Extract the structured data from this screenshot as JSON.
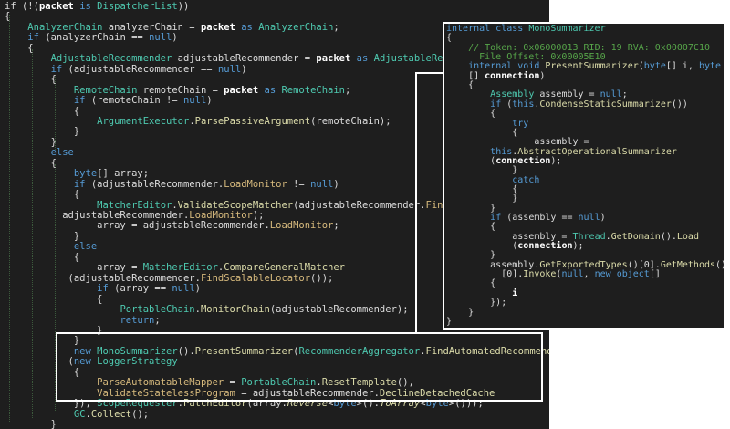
{
  "editor": {
    "lines": [
      [
        {
          "t": "if (!(",
          "c": ""
        },
        {
          "t": "packet",
          "c": "bold"
        },
        {
          "t": " is ",
          "c": "kw"
        },
        {
          "t": "DispatcherList",
          "c": "ty"
        },
        {
          "t": "))",
          "c": ""
        }
      ],
      [
        {
          "t": "{",
          "c": ""
        }
      ],
      [
        {
          "t": "    ",
          "c": ""
        },
        {
          "t": "AnalyzerChain",
          "c": "ty"
        },
        {
          "t": " analyzerChain = ",
          "c": ""
        },
        {
          "t": "packet",
          "c": "bold"
        },
        {
          "t": " as ",
          "c": "kw"
        },
        {
          "t": "AnalyzerChain",
          "c": "ty"
        },
        {
          "t": ";",
          "c": ""
        }
      ],
      [
        {
          "t": "    ",
          "c": ""
        },
        {
          "t": "if",
          "c": "kw"
        },
        {
          "t": " (analyzerChain == ",
          "c": ""
        },
        {
          "t": "null",
          "c": "kw"
        },
        {
          "t": ")",
          "c": ""
        }
      ],
      [
        {
          "t": "    {",
          "c": ""
        }
      ],
      [
        {
          "t": "        ",
          "c": ""
        },
        {
          "t": "AdjustableRecommender",
          "c": "ty"
        },
        {
          "t": " adjustableRecommender = ",
          "c": ""
        },
        {
          "t": "packet",
          "c": "bold"
        },
        {
          "t": " as ",
          "c": "kw"
        },
        {
          "t": "AdjustableRecommender",
          "c": "ty"
        },
        {
          "t": ";",
          "c": ""
        }
      ],
      [
        {
          "t": "        ",
          "c": ""
        },
        {
          "t": "if",
          "c": "kw"
        },
        {
          "t": " (adjustableRecommender == ",
          "c": ""
        },
        {
          "t": "null",
          "c": "kw"
        },
        {
          "t": ")",
          "c": ""
        }
      ],
      [
        {
          "t": "        {",
          "c": ""
        }
      ],
      [
        {
          "t": "            ",
          "c": ""
        },
        {
          "t": "RemoteChain",
          "c": "ty"
        },
        {
          "t": " remoteChain = ",
          "c": ""
        },
        {
          "t": "packet",
          "c": "bold"
        },
        {
          "t": " as ",
          "c": "kw"
        },
        {
          "t": "RemoteChain",
          "c": "ty"
        },
        {
          "t": ";",
          "c": ""
        }
      ],
      [
        {
          "t": "            ",
          "c": ""
        },
        {
          "t": "if",
          "c": "kw"
        },
        {
          "t": " (remoteChain != ",
          "c": ""
        },
        {
          "t": "null",
          "c": "kw"
        },
        {
          "t": ")",
          "c": ""
        }
      ],
      [
        {
          "t": "            {",
          "c": ""
        }
      ],
      [
        {
          "t": "                ",
          "c": ""
        },
        {
          "t": "ArgumentExecutor",
          "c": "ty"
        },
        {
          "t": ".",
          "c": ""
        },
        {
          "t": "ParsePassiveArgument",
          "c": "fn"
        },
        {
          "t": "(remoteChain);",
          "c": ""
        }
      ],
      [
        {
          "t": "            }",
          "c": ""
        }
      ],
      [
        {
          "t": "        }",
          "c": ""
        }
      ],
      [
        {
          "t": "        ",
          "c": ""
        },
        {
          "t": "else",
          "c": "kw"
        }
      ],
      [
        {
          "t": "        {",
          "c": ""
        }
      ],
      [
        {
          "t": "            ",
          "c": ""
        },
        {
          "t": "byte",
          "c": "kw"
        },
        {
          "t": "[] array;",
          "c": ""
        }
      ],
      [
        {
          "t": "            ",
          "c": ""
        },
        {
          "t": "if",
          "c": "kw"
        },
        {
          "t": " (adjustableRecommender.",
          "c": ""
        },
        {
          "t": "LoadMonitor",
          "c": "pr"
        },
        {
          "t": " != ",
          "c": ""
        },
        {
          "t": "null",
          "c": "kw"
        },
        {
          "t": ")",
          "c": ""
        }
      ],
      [
        {
          "t": "            {",
          "c": ""
        }
      ],
      [
        {
          "t": "                ",
          "c": ""
        },
        {
          "t": "MatcherEditor",
          "c": "ty"
        },
        {
          "t": ".",
          "c": ""
        },
        {
          "t": "ValidateScopeMatcher",
          "c": "fn"
        },
        {
          "t": "(adjustableRecommender.",
          "c": ""
        },
        {
          "t": "FindScalableLocator",
          "c": "pr"
        },
        {
          "t": "(),",
          "c": ""
        }
      ],
      [
        {
          "t": "          adjustableRecommender.",
          "c": ""
        },
        {
          "t": "LoadMonitor",
          "c": "pr"
        },
        {
          "t": ");",
          "c": ""
        }
      ],
      [
        {
          "t": "                array = adjustableRecommender.",
          "c": ""
        },
        {
          "t": "LoadMonitor",
          "c": "pr"
        },
        {
          "t": ";",
          "c": ""
        }
      ],
      [
        {
          "t": "            }",
          "c": ""
        }
      ],
      [
        {
          "t": "            ",
          "c": ""
        },
        {
          "t": "else",
          "c": "kw"
        }
      ],
      [
        {
          "t": "            {",
          "c": ""
        }
      ],
      [
        {
          "t": "                array = ",
          "c": ""
        },
        {
          "t": "MatcherEditor",
          "c": "ty"
        },
        {
          "t": ".",
          "c": ""
        },
        {
          "t": "CompareGeneralMatcher",
          "c": "fn"
        }
      ],
      [
        {
          "t": "           (adjustableRecommender.",
          "c": ""
        },
        {
          "t": "FindScalableLocator",
          "c": "pr"
        },
        {
          "t": "());",
          "c": ""
        }
      ],
      [
        {
          "t": "                ",
          "c": ""
        },
        {
          "t": "if",
          "c": "kw"
        },
        {
          "t": " (array == ",
          "c": ""
        },
        {
          "t": "null",
          "c": "kw"
        },
        {
          "t": ")",
          "c": ""
        }
      ],
      [
        {
          "t": "                {",
          "c": ""
        }
      ],
      [
        {
          "t": "                    ",
          "c": ""
        },
        {
          "t": "PortableChain",
          "c": "ty"
        },
        {
          "t": ".",
          "c": ""
        },
        {
          "t": "MonitorChain",
          "c": "fn"
        },
        {
          "t": "(adjustableRecommender);",
          "c": ""
        }
      ],
      [
        {
          "t": "                    ",
          "c": ""
        },
        {
          "t": "return",
          "c": "kw"
        },
        {
          "t": ";",
          "c": ""
        }
      ],
      [
        {
          "t": "                }",
          "c": ""
        }
      ],
      [
        {
          "t": "            }",
          "c": ""
        }
      ],
      [
        {
          "t": "            ",
          "c": ""
        },
        {
          "t": "new",
          "c": "kw"
        },
        {
          "t": " ",
          "c": ""
        },
        {
          "t": "MonoSummarizer",
          "c": "ty"
        },
        {
          "t": "().",
          "c": ""
        },
        {
          "t": "PresentSummarizer",
          "c": "fn"
        },
        {
          "t": "(",
          "c": ""
        },
        {
          "t": "RecommenderAggregator",
          "c": "ty"
        },
        {
          "t": ".",
          "c": ""
        },
        {
          "t": "FindAutomatedRecommender",
          "c": "fn"
        }
      ],
      [
        {
          "t": "           (",
          "c": ""
        },
        {
          "t": "new",
          "c": "kw"
        },
        {
          "t": " ",
          "c": ""
        },
        {
          "t": "LoggerStrategy",
          "c": "ty"
        }
      ],
      [
        {
          "t": "            {",
          "c": ""
        }
      ],
      [
        {
          "t": "                ",
          "c": ""
        },
        {
          "t": "ParseAutomatableMapper",
          "c": "pr"
        },
        {
          "t": " = ",
          "c": ""
        },
        {
          "t": "PortableChain",
          "c": "ty"
        },
        {
          "t": ".",
          "c": ""
        },
        {
          "t": "ResetTemplate",
          "c": "fn"
        },
        {
          "t": "(),",
          "c": ""
        }
      ],
      [
        {
          "t": "                ",
          "c": ""
        },
        {
          "t": "ValidateStatelessProgram",
          "c": "pr"
        },
        {
          "t": " = adjustableRecommender.",
          "c": ""
        },
        {
          "t": "DeclineDetachedCache",
          "c": "fn"
        }
      ],
      [
        {
          "t": "            }), ",
          "c": ""
        },
        {
          "t": "ScopeRequester",
          "c": "ty"
        },
        {
          "t": ".",
          "c": ""
        },
        {
          "t": "PatchEditor",
          "c": "fn"
        },
        {
          "t": "(array.",
          "c": ""
        },
        {
          "t": "Reverse",
          "c": "fn it"
        },
        {
          "t": "<",
          "c": ""
        },
        {
          "t": "byte",
          "c": "kw"
        },
        {
          "t": ">().",
          "c": ""
        },
        {
          "t": "ToArray",
          "c": "fn it"
        },
        {
          "t": "<",
          "c": ""
        },
        {
          "t": "byte",
          "c": "kw"
        },
        {
          "t": ">()));",
          "c": ""
        }
      ],
      [
        {
          "t": "            ",
          "c": ""
        },
        {
          "t": "GC",
          "c": "ty"
        },
        {
          "t": ".",
          "c": ""
        },
        {
          "t": "Collect",
          "c": "fn"
        },
        {
          "t": "();",
          "c": ""
        }
      ],
      [
        {
          "t": "        }",
          "c": ""
        }
      ],
      [
        {
          "t": "    }",
          "c": ""
        }
      ]
    ]
  },
  "popup": {
    "lines": [
      [
        {
          "t": "internal class ",
          "c": "kw"
        },
        {
          "t": "MonoSummarizer",
          "c": "ty"
        }
      ],
      [
        {
          "t": "{",
          "c": ""
        }
      ],
      [
        {
          "t": "    ",
          "c": ""
        },
        {
          "t": "// Token: 0x06000013 RID: 19 RVA: 0x00007C10",
          "c": "cm"
        }
      ],
      [
        {
          "t": "      ",
          "c": ""
        },
        {
          "t": "File Offset: 0x00005E10",
          "c": "cm"
        }
      ],
      [
        {
          "t": "    ",
          "c": ""
        },
        {
          "t": "internal void ",
          "c": "kw"
        },
        {
          "t": "PresentSummarizer",
          "c": "fn"
        },
        {
          "t": "(",
          "c": ""
        },
        {
          "t": "byte",
          "c": "kw"
        },
        {
          "t": "[] i, ",
          "c": ""
        },
        {
          "t": "byte",
          "c": "kw"
        }
      ],
      [
        {
          "t": "    [] ",
          "c": ""
        },
        {
          "t": "connection",
          "c": "bold"
        },
        {
          "t": ")",
          "c": ""
        }
      ],
      [
        {
          "t": "    {",
          "c": ""
        }
      ],
      [
        {
          "t": "        ",
          "c": ""
        },
        {
          "t": "Assembly",
          "c": "ty"
        },
        {
          "t": " assembly = ",
          "c": ""
        },
        {
          "t": "null",
          "c": "kw"
        },
        {
          "t": ";",
          "c": ""
        }
      ],
      [
        {
          "t": "        ",
          "c": ""
        },
        {
          "t": "if",
          "c": "kw"
        },
        {
          "t": " (",
          "c": ""
        },
        {
          "t": "this",
          "c": "kw"
        },
        {
          "t": ".",
          "c": ""
        },
        {
          "t": "CondenseStaticSummarizer",
          "c": "fn"
        },
        {
          "t": "())",
          "c": ""
        }
      ],
      [
        {
          "t": "        {",
          "c": ""
        }
      ],
      [
        {
          "t": "            ",
          "c": ""
        },
        {
          "t": "try",
          "c": "kw"
        }
      ],
      [
        {
          "t": "            {",
          "c": ""
        }
      ],
      [
        {
          "t": "                assembly =",
          "c": ""
        }
      ],
      [
        {
          "t": "        ",
          "c": ""
        },
        {
          "t": "this",
          "c": "kw"
        },
        {
          "t": ".",
          "c": ""
        },
        {
          "t": "AbstractOperationalSummarizer",
          "c": "fn"
        }
      ],
      [
        {
          "t": "        (",
          "c": ""
        },
        {
          "t": "connection",
          "c": "bold"
        },
        {
          "t": ");",
          "c": ""
        }
      ],
      [
        {
          "t": "            }",
          "c": ""
        }
      ],
      [
        {
          "t": "            ",
          "c": ""
        },
        {
          "t": "catch",
          "c": "kw"
        }
      ],
      [
        {
          "t": "            {",
          "c": ""
        }
      ],
      [
        {
          "t": "            }",
          "c": ""
        }
      ],
      [
        {
          "t": "        }",
          "c": ""
        }
      ],
      [
        {
          "t": "        ",
          "c": ""
        },
        {
          "t": "if",
          "c": "kw"
        },
        {
          "t": " (assembly == ",
          "c": ""
        },
        {
          "t": "null",
          "c": "kw"
        },
        {
          "t": ")",
          "c": ""
        }
      ],
      [
        {
          "t": "        {",
          "c": ""
        }
      ],
      [
        {
          "t": "            assembly = ",
          "c": ""
        },
        {
          "t": "Thread",
          "c": "ty"
        },
        {
          "t": ".",
          "c": ""
        },
        {
          "t": "GetDomain",
          "c": "fn"
        },
        {
          "t": "().",
          "c": ""
        },
        {
          "t": "Load",
          "c": "fn"
        }
      ],
      [
        {
          "t": "            (",
          "c": ""
        },
        {
          "t": "connection",
          "c": "bold"
        },
        {
          "t": ");",
          "c": ""
        }
      ],
      [
        {
          "t": "        }",
          "c": ""
        }
      ],
      [
        {
          "t": "        assembly.",
          "c": ""
        },
        {
          "t": "GetExportedTypes",
          "c": "fn"
        },
        {
          "t": "()[0].",
          "c": ""
        },
        {
          "t": "GetMethods",
          "c": "fn"
        },
        {
          "t": "()",
          "c": ""
        }
      ],
      [
        {
          "t": "          [0].",
          "c": ""
        },
        {
          "t": "Invoke",
          "c": "fn"
        },
        {
          "t": "(",
          "c": ""
        },
        {
          "t": "null",
          "c": "kw"
        },
        {
          "t": ", ",
          "c": ""
        },
        {
          "t": "new",
          "c": "kw"
        },
        {
          "t": " ",
          "c": ""
        },
        {
          "t": "object",
          "c": "kw"
        },
        {
          "t": "[]",
          "c": ""
        }
      ],
      [
        {
          "t": "        {",
          "c": ""
        }
      ],
      [
        {
          "t": "            i",
          "c": "bold"
        }
      ],
      [
        {
          "t": "        });",
          "c": ""
        }
      ],
      [
        {
          "t": "    }",
          "c": ""
        }
      ],
      [
        {
          "t": "}",
          "c": ""
        }
      ]
    ]
  }
}
